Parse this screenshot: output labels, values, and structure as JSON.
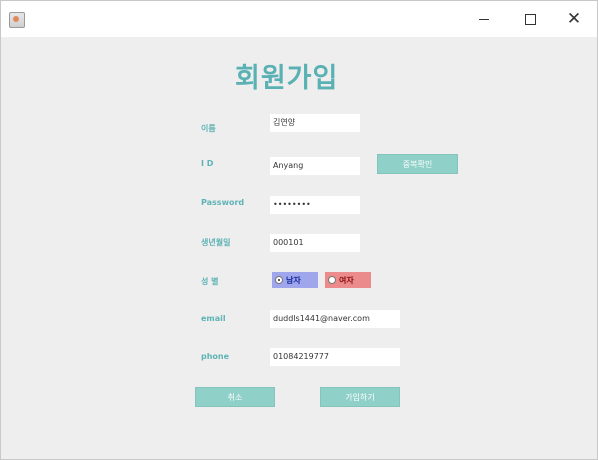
{
  "window": {
    "controls": {
      "minimize": "minimize-icon",
      "maximize": "maximize-icon",
      "close": "close-icon"
    }
  },
  "form": {
    "title": "회원가입",
    "fields": {
      "name": {
        "label": "이름",
        "value": "김연양"
      },
      "id": {
        "label": "I D",
        "value": "Anyang"
      },
      "password": {
        "label": "Password",
        "value": "••••••••"
      },
      "birth": {
        "label": "생년월일",
        "value": "000101"
      },
      "gender": {
        "label": "성 별"
      },
      "email": {
        "label": "email",
        "value": "duddls1441@naver.com"
      },
      "phone": {
        "label": "phone",
        "value": "01084219777"
      }
    },
    "gender_options": {
      "male": "남자",
      "female": "여자",
      "selected": "male"
    },
    "buttons": {
      "check_dup": "중복확인",
      "cancel": "취소",
      "submit": "가입하기"
    },
    "colors": {
      "accent": "#5ab1b3",
      "button": "#8fd0c8",
      "male_bg": "#9fa6ec",
      "female_bg": "#ec8b8b"
    }
  }
}
